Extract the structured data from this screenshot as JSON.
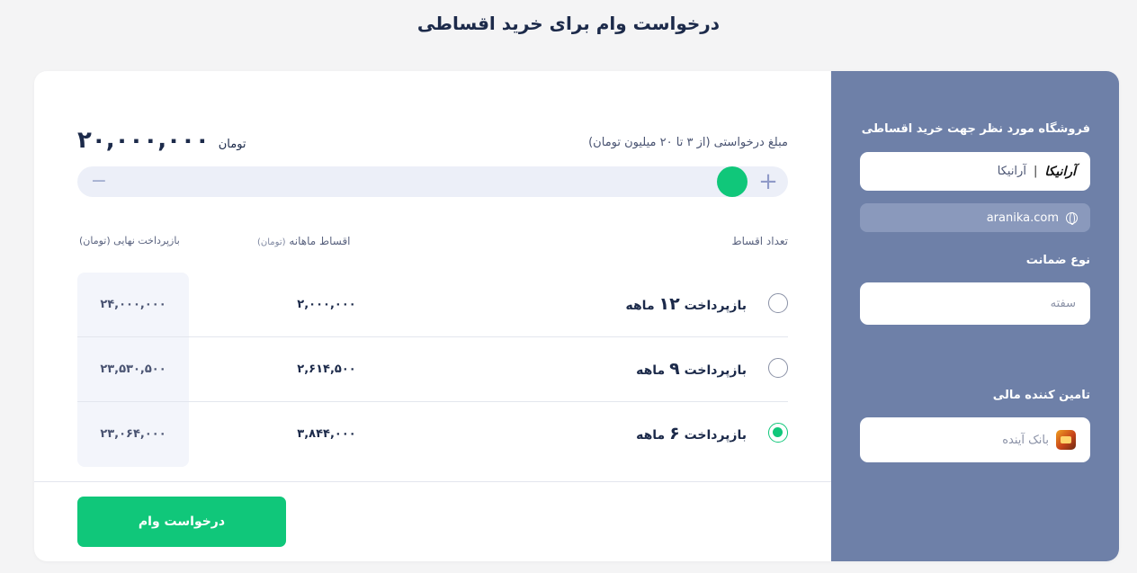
{
  "page": {
    "title": "درخواست وام برای خرید اقساطی"
  },
  "amount": {
    "label": "مبلغ درخواستی (از ۳ تا ۲۰ میلیون تومان)",
    "value": "۲۰,۰۰۰,۰۰۰",
    "unit": "تومان",
    "min_million": 3,
    "max_million": 20,
    "current_million": 20,
    "minus_symbol": "−",
    "plus_symbol": "+"
  },
  "table": {
    "col_count": "تعداد اقساط",
    "col_monthly": "اقساط ماهانه",
    "col_monthly_unit": "(تومان)",
    "col_final": "بازپرداخت نهایی (تومان)",
    "rows": [
      {
        "prefix": "بازپرداخت",
        "num": "۱۲",
        "suffix": "ماهه",
        "monthly": "۲,۰۰۰,۰۰۰",
        "final": "۲۴,۰۰۰,۰۰۰",
        "selected": false
      },
      {
        "prefix": "بازپرداخت",
        "num": "۹",
        "suffix": "ماهه",
        "monthly": "۲,۶۱۴,۵۰۰",
        "final": "۲۳,۵۳۰,۵۰۰",
        "selected": false
      },
      {
        "prefix": "بازپرداخت",
        "num": "۶",
        "suffix": "ماهه",
        "monthly": "۳,۸۴۴,۰۰۰",
        "final": "۲۳,۰۶۴,۰۰۰",
        "selected": true
      }
    ]
  },
  "submit": {
    "label": "درخواست وام"
  },
  "sidebar": {
    "store_label": "فروشگاه مورد نظر جهت خرید اقساطی",
    "store_logo": "آرانیکا",
    "store_separator": "|",
    "store_name": "آرانیکا",
    "store_site": "aranika.com",
    "guarantee_label": "نوع ضمانت",
    "guarantee_placeholder": "سفته",
    "provider_label": "تامین کننده مالی",
    "provider_name": "بانک آینده"
  },
  "colors": {
    "accent": "#10c77a",
    "sidebar": "#6e80a8",
    "text": "#1c2a4a"
  }
}
